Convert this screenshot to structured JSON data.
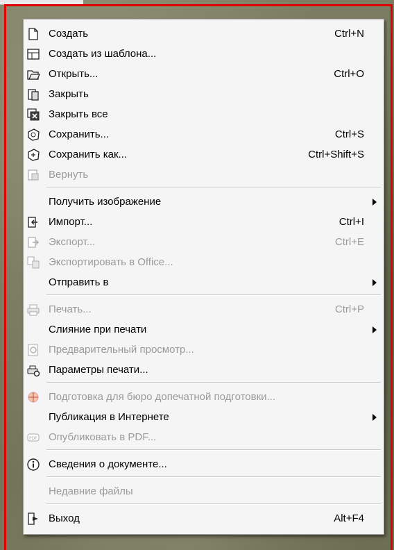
{
  "menu": {
    "items": [
      {
        "label": "Создать",
        "shortcut": "Ctrl+N"
      },
      {
        "label": "Создать из шаблона...",
        "shortcut": ""
      },
      {
        "label": "Открыть...",
        "shortcut": "Ctrl+O"
      },
      {
        "label": "Закрыть",
        "shortcut": ""
      },
      {
        "label": "Закрыть все",
        "shortcut": ""
      },
      {
        "label": "Сохранить...",
        "shortcut": "Ctrl+S"
      },
      {
        "label": "Сохранить как...",
        "shortcut": "Ctrl+Shift+S"
      },
      {
        "label": "Вернуть",
        "shortcut": ""
      },
      {
        "label": "Получить изображение",
        "shortcut": ""
      },
      {
        "label": "Импорт...",
        "shortcut": "Ctrl+I"
      },
      {
        "label": "Экспорт...",
        "shortcut": "Ctrl+E"
      },
      {
        "label": "Экспортировать в Office...",
        "shortcut": ""
      },
      {
        "label": "Отправить в",
        "shortcut": ""
      },
      {
        "label": "Печать...",
        "shortcut": "Ctrl+P"
      },
      {
        "label": "Слияние при печати",
        "shortcut": ""
      },
      {
        "label": "Предварительный просмотр...",
        "shortcut": ""
      },
      {
        "label": "Параметры печати...",
        "shortcut": ""
      },
      {
        "label": "Подготовка для бюро допечатной подготовки...",
        "shortcut": ""
      },
      {
        "label": "Публикация в Интернете",
        "shortcut": ""
      },
      {
        "label": "Опубликовать в PDF...",
        "shortcut": ""
      },
      {
        "label": "Сведения о документе...",
        "shortcut": ""
      },
      {
        "label": "Недавние файлы",
        "shortcut": ""
      },
      {
        "label": "Выход",
        "shortcut": "Alt+F4"
      }
    ]
  },
  "colors": {
    "frame": "#e00000",
    "menu_bg": "#f5f5f5",
    "disabled_text": "#9a9a9a"
  }
}
